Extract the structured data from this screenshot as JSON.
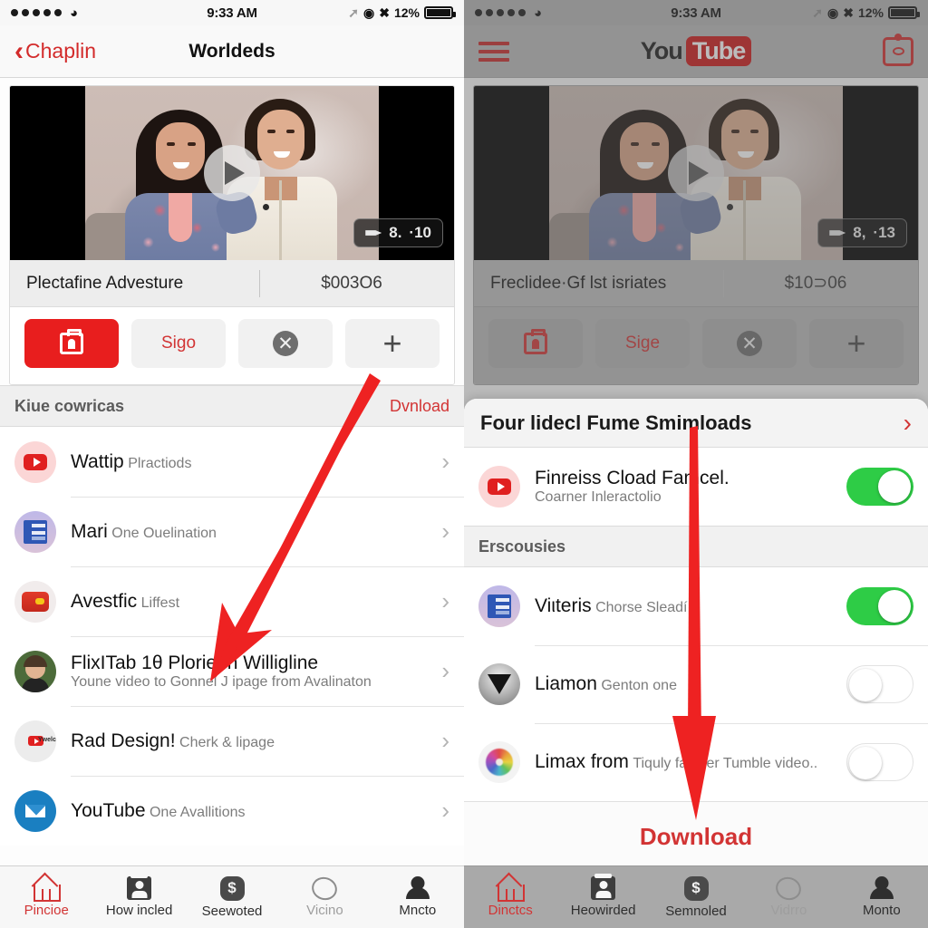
{
  "status_bar": {
    "signal_dots": 5,
    "wifi_icon": "wifi-icon",
    "time": "9:33 AM",
    "battery_percent": "12%",
    "icons": [
      "airplane-icon",
      "alarm-icon",
      "location-icon"
    ]
  },
  "left": {
    "nav": {
      "back_label": "Chaplin",
      "title": "Worldeds"
    },
    "video": {
      "badge_count": "8.",
      "badge_time": "·10",
      "title": "Plectafine Advesture",
      "price": "$003O6",
      "play_icon": "play-icon"
    },
    "actions": [
      {
        "name": "briefcase-button",
        "label": "",
        "icon": "briefcase-icon",
        "style": "primary"
      },
      {
        "name": "sign-button",
        "label": "Sigo",
        "icon": "",
        "style": "plain"
      },
      {
        "name": "cancel-button",
        "label": "",
        "icon": "x-circle-icon",
        "style": "plain"
      },
      {
        "name": "add-button",
        "label": "",
        "icon": "plus-icon",
        "style": "plain"
      }
    ],
    "section": {
      "title": "Kiue cowricas",
      "action": "Dvnload"
    },
    "items": [
      {
        "title": "Wattip",
        "subtitle": "Plractiods",
        "avatar": "youtube-icon"
      },
      {
        "title": "Mari",
        "subtitle": "One Ouelination",
        "avatar": "book-icon"
      },
      {
        "title": "Avestfic",
        "subtitle": "Liffest",
        "avatar": "balloon-icon"
      },
      {
        "title": "FlixITab 1θ Plorie In Willigline",
        "subtitle": "Youne video to Gonnel J ipage from Avalinaton",
        "avatar": "person-photo-icon"
      },
      {
        "title": "Rad Design!",
        "subtitle": "Cherk & lipage",
        "avatar": "youtube-wordmark-icon"
      },
      {
        "title": "YouTube",
        "subtitle": "One Avallitions",
        "avatar": "mail-icon"
      }
    ],
    "tabs": [
      {
        "label": "Pincioe",
        "icon": "home-icon",
        "state": "active"
      },
      {
        "label": "How incled",
        "icon": "card-icon",
        "state": "normal"
      },
      {
        "label": "Seewoted",
        "icon": "dollar-icon",
        "state": "normal"
      },
      {
        "label": "Vicino",
        "icon": "circle-icon",
        "state": "muted"
      },
      {
        "label": "Mncto",
        "icon": "person-icon",
        "state": "normal"
      }
    ]
  },
  "right": {
    "nav": {
      "menu_icon": "hamburger-icon",
      "logo_you": "You",
      "logo_tube": "Tube",
      "cast_icon": "cast-icon"
    },
    "video": {
      "badge_count": "8,",
      "badge_time": "·13",
      "title": "Freclidee·Gf lst isriates",
      "price": "$10⊃06",
      "play_icon": "play-icon"
    },
    "actions": [
      {
        "name": "briefcase-button",
        "label": "",
        "icon": "briefcase-icon",
        "style": "plain"
      },
      {
        "name": "sign-button",
        "label": "Sige",
        "icon": "",
        "style": "plain"
      },
      {
        "name": "cancel-button",
        "label": "",
        "icon": "x-circle-icon",
        "style": "plain"
      },
      {
        "name": "add-button",
        "label": "",
        "icon": "plus-icon",
        "style": "plain"
      }
    ],
    "sheet": {
      "header": "Four lidecl Fume Smimloads",
      "header_chevron": "chevron-right-icon",
      "first_item": {
        "title": "Finreiss Cload Famcel.",
        "subtitle": "Coarner Inleractolio",
        "avatar": "youtube-icon",
        "toggle": "on"
      },
      "section_title": "Erscousies",
      "items": [
        {
          "title": "Viιteris",
          "subtitle": "Chorse Sleadí..",
          "avatar": "book-icon",
          "toggle": "on"
        },
        {
          "title": "Liamon",
          "subtitle": "Genton one",
          "avatar": "dropbox-icon",
          "toggle": "off"
        },
        {
          "title": "Limax from",
          "subtitle": "Tiquly famver Tumble video..",
          "avatar": "photos-flower-icon",
          "toggle": "off"
        }
      ],
      "download_label": "Download"
    },
    "tabs": [
      {
        "label": "Dinctcs",
        "icon": "home-icon",
        "state": "active"
      },
      {
        "label": "Heowirded",
        "icon": "card-icon",
        "state": "normal"
      },
      {
        "label": "Semnoled",
        "icon": "dollar-icon",
        "state": "normal"
      },
      {
        "label": "Vidrro",
        "icon": "circle-icon",
        "state": "muted"
      },
      {
        "label": "Monto",
        "icon": "person-icon",
        "state": "normal"
      }
    ]
  },
  "annotations": {
    "arrow_color": "#ee2222",
    "arrow_left": "points from plus-button down to list area",
    "arrow_right": "points from sheet down to Download button"
  }
}
